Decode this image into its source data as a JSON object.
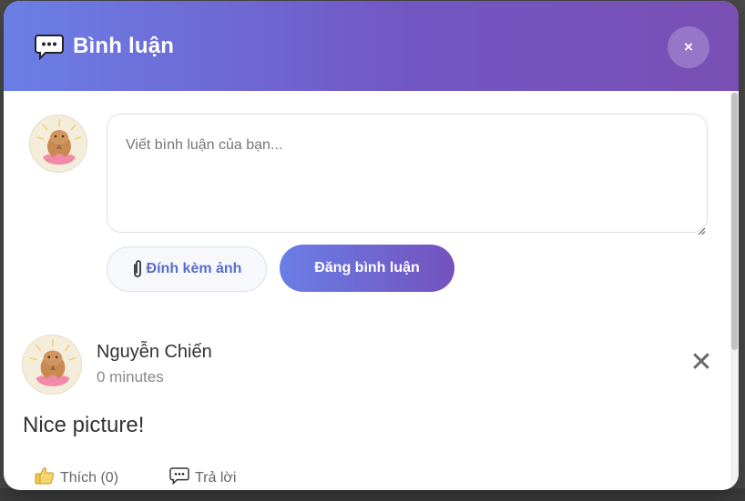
{
  "modal": {
    "title": "Bình luận",
    "close_label": "×"
  },
  "composer": {
    "placeholder": "Viết bình luận của bạn...",
    "attach_label": "Đính kèm ảnh",
    "post_label": "Đăng bình luận"
  },
  "comment": {
    "author": "Nguyễn Chiến",
    "time": "0 minutes",
    "text": "Nice picture!",
    "delete_label": "✕",
    "like_label": "Thích (0)",
    "reply_label": "Trả lời"
  },
  "colors": {
    "header_gradient_start": "#6a7fe6",
    "header_gradient_end": "#7a4fb4",
    "accent": "#5b6cc9"
  },
  "icons": {
    "title": "speech-bubble-icon",
    "attach": "paperclip-icon",
    "like": "thumbs-up-icon",
    "reply": "speech-bubble-icon"
  }
}
